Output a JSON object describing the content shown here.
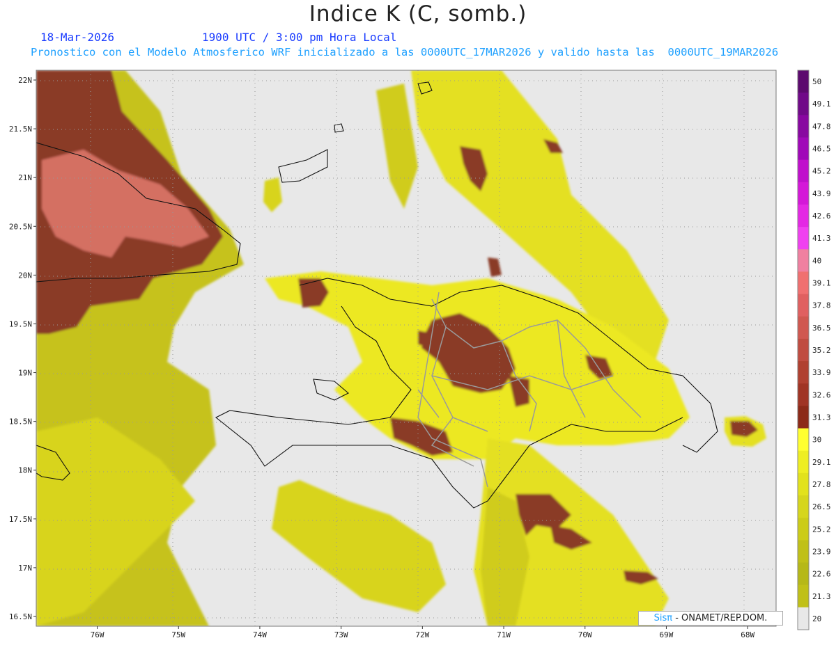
{
  "header": {
    "title": "Indice K (C, somb.)",
    "date": "18-Mar-2026",
    "time": "1900 UTC / 3:00 pm Hora Local",
    "description": "Pronostico con el Modelo Atmosferico WRF inicializado a las 0000UTC_17MAR2026 y valido hasta las  0000UTC_19MAR2026"
  },
  "map": {
    "lat_labels": [
      "22N",
      "21.5N",
      "21N",
      "20.5N",
      "20N",
      "19.5N",
      "19N",
      "18.5N",
      "18N",
      "17.5N",
      "17N",
      "16.5N"
    ],
    "lon_labels": [
      "76W",
      "75W",
      "74W",
      "73W",
      "72W",
      "71W",
      "70W",
      "69W",
      "68W"
    ],
    "lat_range": [
      16.4,
      22.1
    ],
    "lon_range": [
      -76.75,
      -67.65
    ]
  },
  "colorbar": {
    "levels": [
      "50",
      "49.1",
      "47.8",
      "46.5",
      "45.2",
      "43.9",
      "42.6",
      "41.3",
      "40",
      "39.1",
      "37.8",
      "36.5",
      "35.2",
      "33.9",
      "32.6",
      "31.3",
      "30",
      "29.1",
      "27.8",
      "26.5",
      "25.2",
      "23.9",
      "22.6",
      "21.3",
      "20"
    ],
    "colors": [
      "#5c0a6e",
      "#700a88",
      "#8808a0",
      "#a008b8",
      "#c010cc",
      "#d418d8",
      "#e428e4",
      "#f040f0",
      "#f080a0",
      "#f07070",
      "#e06060",
      "#d05850",
      "#c04c40",
      "#b04030",
      "#a03424",
      "#8c2a18",
      "#ffff30",
      "#eeee22",
      "#e2e21c",
      "#d6d61c",
      "#cccc18",
      "#c0c018",
      "#b6b818",
      "#c0c018",
      "#e8e8e8"
    ]
  },
  "colors": {
    "background_no_value": "#e8e8e8",
    "low": "#c8c818",
    "mid": "#e8e820",
    "high": "#8a3a26",
    "very_high": "#d86f66"
  },
  "credit": {
    "brand": "Sisπ",
    "org": "- ONAMET/REP.DOM."
  }
}
